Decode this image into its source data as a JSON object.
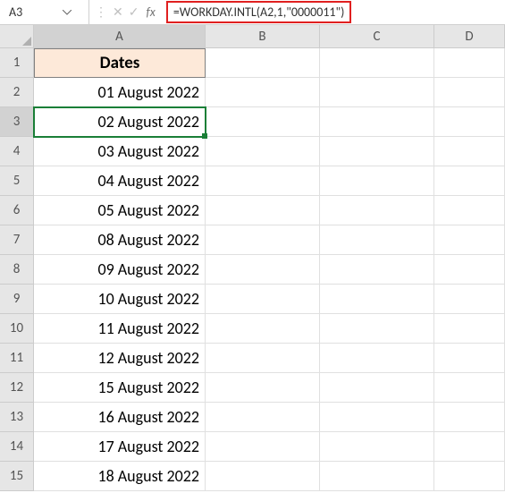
{
  "namebox": {
    "value": "A3"
  },
  "formula": {
    "text": "=WORKDAY.INTL(A2,1,\"0000011\")"
  },
  "columns": {
    "A": "A",
    "B": "B",
    "C": "C",
    "D": "D"
  },
  "header": {
    "A1": "Dates"
  },
  "rows": [
    {
      "num": "1",
      "A": "Dates"
    },
    {
      "num": "2",
      "A": "01 August 2022"
    },
    {
      "num": "3",
      "A": "02 August 2022"
    },
    {
      "num": "4",
      "A": "03 August 2022"
    },
    {
      "num": "5",
      "A": "04 August 2022"
    },
    {
      "num": "6",
      "A": "05 August 2022"
    },
    {
      "num": "7",
      "A": "08 August 2022"
    },
    {
      "num": "8",
      "A": "09 August 2022"
    },
    {
      "num": "9",
      "A": "10 August 2022"
    },
    {
      "num": "10",
      "A": "11 August 2022"
    },
    {
      "num": "11",
      "A": "12 August 2022"
    },
    {
      "num": "12",
      "A": "15 August 2022"
    },
    {
      "num": "13",
      "A": "16 August 2022"
    },
    {
      "num": "14",
      "A": "17 August 2022"
    },
    {
      "num": "15",
      "A": "18 August 2022"
    }
  ],
  "active_cell": {
    "ref": "A3",
    "row_index": 2,
    "col": "A"
  }
}
